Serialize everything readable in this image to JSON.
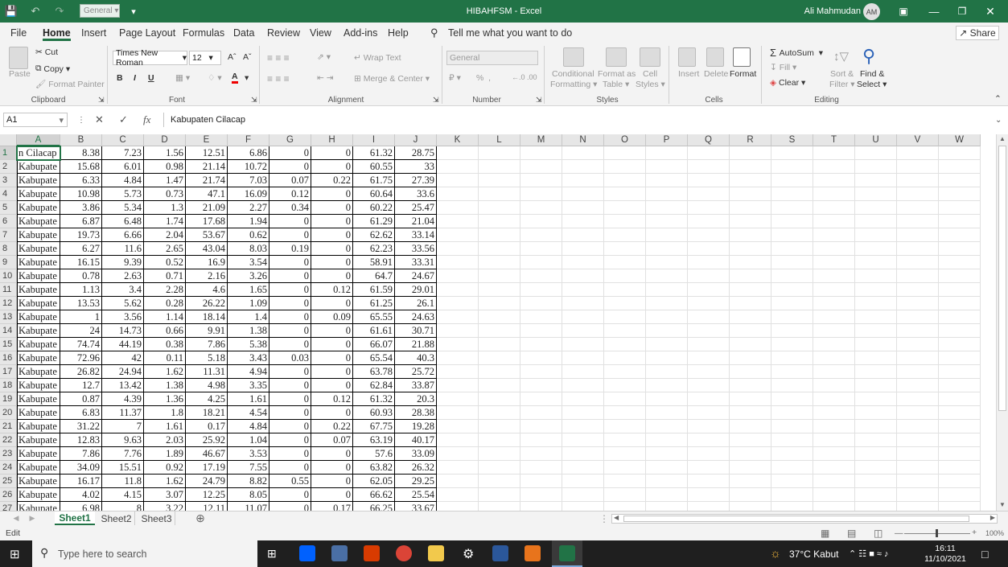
{
  "window": {
    "title": "HIBAHFSM  -  Excel",
    "user_name": "Ali Mahmudan",
    "user_initials": "AM",
    "qat_format": "General"
  },
  "menu": {
    "tabs": [
      "File",
      "Home",
      "Insert",
      "Page Layout",
      "Formulas",
      "Data",
      "Review",
      "View",
      "Add-ins",
      "Help"
    ],
    "tell_me": "Tell me what you want to do",
    "share": "Share"
  },
  "ribbon": {
    "clipboard": {
      "paste": "Paste",
      "cut": "Cut",
      "copy": "Copy",
      "format_painter": "Format Painter",
      "label": "Clipboard"
    },
    "font": {
      "name": "Times New Roman",
      "size": "12",
      "label": "Font",
      "bold": "B",
      "italic": "I",
      "underline": "U"
    },
    "alignment": {
      "wrap": "Wrap Text",
      "merge": "Merge & Center",
      "label": "Alignment"
    },
    "number": {
      "format": "General",
      "label": "Number"
    },
    "styles": {
      "conditional": "Conditional",
      "formatting": "Formatting",
      "format_as": "Format as",
      "table": "Table",
      "cell": "Cell",
      "cell_styles": "Styles",
      "label": "Styles"
    },
    "cells": {
      "insert": "Insert",
      "delete": "Delete",
      "format": "Format",
      "label": "Cells"
    },
    "editing": {
      "autosum": "AutoSum",
      "fill": "Fill",
      "clear": "Clear",
      "sort": "Sort &",
      "filter": "Filter",
      "find": "Find &",
      "select": "Select",
      "label": "Editing"
    }
  },
  "formula_bar": {
    "name_box": "A1",
    "fx": "fx",
    "content": "Kabupaten Cilacap"
  },
  "grid": {
    "columns": [
      "A",
      "B",
      "C",
      "D",
      "E",
      "F",
      "G",
      "H",
      "I",
      "J",
      "K",
      "L",
      "M",
      "N",
      "O",
      "P",
      "Q",
      "R",
      "S",
      "T",
      "U",
      "V",
      "W"
    ],
    "row_numbers": [
      "1",
      "2",
      "3",
      "4",
      "5",
      "6",
      "7",
      "8",
      "9",
      "10",
      "11",
      "12",
      "13",
      "14",
      "15",
      "16",
      "17",
      "18",
      "19",
      "20",
      "21",
      "22",
      "23",
      "24",
      "25",
      "26",
      "27"
    ],
    "rows": [
      [
        "n Cilacap",
        "8.38",
        "7.23",
        "1.56",
        "12.51",
        "6.86",
        "0",
        "0",
        "61.32",
        "28.75"
      ],
      [
        "Kabupate",
        "15.68",
        "6.01",
        "0.98",
        "21.14",
        "10.72",
        "0",
        "0",
        "60.55",
        "33"
      ],
      [
        "Kabupate",
        "6.33",
        "4.84",
        "1.47",
        "21.74",
        "7.03",
        "0.07",
        "0.22",
        "61.75",
        "27.39"
      ],
      [
        "Kabupate",
        "10.98",
        "5.73",
        "0.73",
        "47.1",
        "16.09",
        "0.12",
        "0",
        "60.64",
        "33.6"
      ],
      [
        "Kabupate",
        "3.86",
        "5.34",
        "1.3",
        "21.09",
        "2.27",
        "0.34",
        "0",
        "60.22",
        "25.47"
      ],
      [
        "Kabupate",
        "6.87",
        "6.48",
        "1.74",
        "17.68",
        "1.94",
        "0",
        "0",
        "61.29",
        "21.04"
      ],
      [
        "Kabupate",
        "19.73",
        "6.66",
        "2.04",
        "53.67",
        "0.62",
        "0",
        "0",
        "62.62",
        "33.14"
      ],
      [
        "Kabupate",
        "6.27",
        "11.6",
        "2.65",
        "43.04",
        "8.03",
        "0.19",
        "0",
        "62.23",
        "33.56"
      ],
      [
        "Kabupate",
        "16.15",
        "9.39",
        "0.52",
        "16.9",
        "3.54",
        "0",
        "0",
        "58.91",
        "33.31"
      ],
      [
        "Kabupate",
        "0.78",
        "2.63",
        "0.71",
        "2.16",
        "3.26",
        "0",
        "0",
        "64.7",
        "24.67"
      ],
      [
        "Kabupate",
        "1.13",
        "3.4",
        "2.28",
        "4.6",
        "1.65",
        "0",
        "0.12",
        "61.59",
        "29.01"
      ],
      [
        "Kabupate",
        "13.53",
        "5.62",
        "0.28",
        "26.22",
        "1.09",
        "0",
        "0",
        "61.25",
        "26.1"
      ],
      [
        "Kabupate",
        "1",
        "3.56",
        "1.14",
        "18.14",
        "1.4",
        "0",
        "0.09",
        "65.55",
        "24.63"
      ],
      [
        "Kabupate",
        "24",
        "14.73",
        "0.66",
        "9.91",
        "1.38",
        "0",
        "0",
        "61.61",
        "30.71"
      ],
      [
        "Kabupate",
        "74.74",
        "44.19",
        "0.38",
        "7.86",
        "5.38",
        "0",
        "0",
        "66.07",
        "21.88"
      ],
      [
        "Kabupate",
        "72.96",
        "42",
        "0.11",
        "5.18",
        "3.43",
        "0.03",
        "0",
        "65.54",
        "40.3"
      ],
      [
        "Kabupate",
        "26.82",
        "24.94",
        "1.62",
        "11.31",
        "4.94",
        "0",
        "0",
        "63.78",
        "25.72"
      ],
      [
        "Kabupate",
        "12.7",
        "13.42",
        "1.38",
        "4.98",
        "3.35",
        "0",
        "0",
        "62.84",
        "33.87"
      ],
      [
        "Kabupate",
        "0.87",
        "4.39",
        "1.36",
        "4.25",
        "1.61",
        "0",
        "0.12",
        "61.32",
        "20.3"
      ],
      [
        "Kabupate",
        "6.83",
        "11.37",
        "1.8",
        "18.21",
        "4.54",
        "0",
        "0",
        "60.93",
        "28.38"
      ],
      [
        "Kabupate",
        "31.22",
        "7",
        "1.61",
        "0.17",
        "4.84",
        "0",
        "0.22",
        "67.75",
        "19.28"
      ],
      [
        "Kabupate",
        "12.83",
        "9.63",
        "2.03",
        "25.92",
        "1.04",
        "0",
        "0.07",
        "63.19",
        "40.17"
      ],
      [
        "Kabupate",
        "7.86",
        "7.76",
        "1.89",
        "46.67",
        "3.53",
        "0",
        "0",
        "57.6",
        "33.09"
      ],
      [
        "Kabupate",
        "34.09",
        "15.51",
        "0.92",
        "17.19",
        "7.55",
        "0",
        "0",
        "63.82",
        "26.32"
      ],
      [
        "Kabupate",
        "16.17",
        "11.8",
        "1.62",
        "24.79",
        "8.82",
        "0.55",
        "0",
        "62.05",
        "29.25"
      ],
      [
        "Kabupate",
        "4.02",
        "4.15",
        "3.07",
        "12.25",
        "8.05",
        "0",
        "0",
        "66.62",
        "25.54"
      ],
      [
        "Kabupate",
        "6.98",
        "8",
        "3.22",
        "12.11",
        "11.07",
        "0",
        "0.17",
        "66.25",
        "33.67"
      ]
    ]
  },
  "sheets": [
    "Sheet1",
    "Sheet2",
    "Sheet3"
  ],
  "status": {
    "mode": "Edit",
    "zoom": "100%"
  },
  "taskbar": {
    "search_placeholder": "Type here to search",
    "weather": "37°C  Kabut",
    "time": "16:11",
    "date": "11/10/2021"
  },
  "colors": {
    "excel_green": "#217346",
    "taskbar": "#1f1f1f"
  }
}
